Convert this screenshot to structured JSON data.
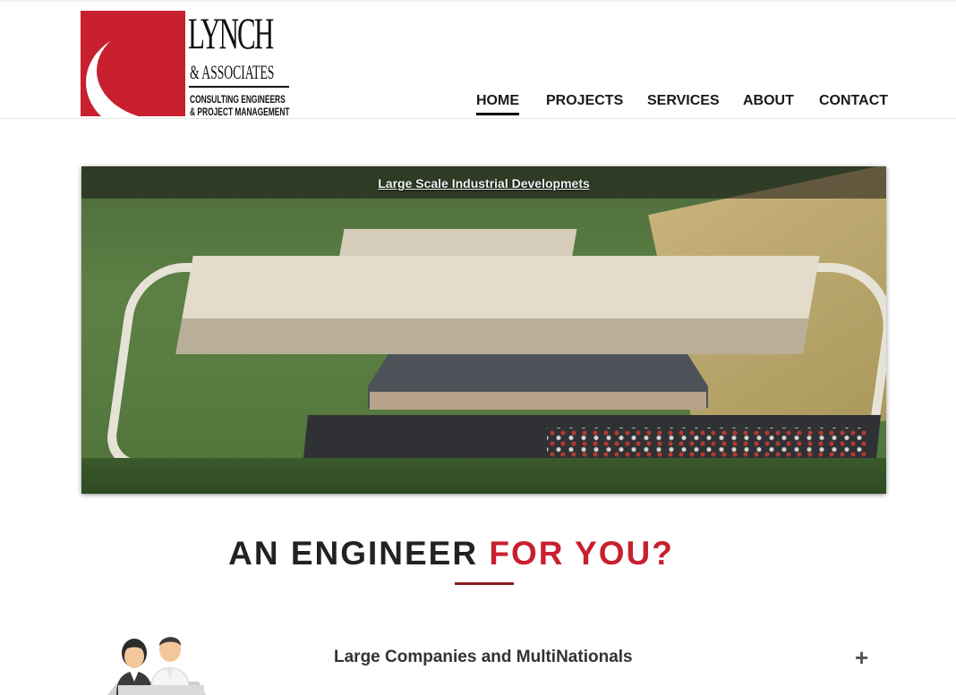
{
  "brand": {
    "logo_main": "LYNCH",
    "logo_sub": "& ASSOCIATES",
    "logo_tag1": "CONSULTING ENGINEERS",
    "logo_tag2": "& PROJECT MANAGEMENT",
    "accent_color": "#c8202f"
  },
  "nav": {
    "items": [
      {
        "label": "HOME",
        "active": true
      },
      {
        "label": "PROJECTS",
        "active": false
      },
      {
        "label": "SERVICES",
        "active": false
      },
      {
        "label": "ABOUT",
        "active": false
      },
      {
        "label": "CONTACT",
        "active": false
      }
    ]
  },
  "hero": {
    "caption": "Large Scale Industrial Developmets"
  },
  "section": {
    "heading_part1": "AN ENGINEER ",
    "heading_part2": "FOR YOU?"
  },
  "accordion": {
    "items": [
      {
        "title": "Large Companies and MultiNationals",
        "toggle": "+",
        "icon": "people-icon"
      }
    ]
  }
}
